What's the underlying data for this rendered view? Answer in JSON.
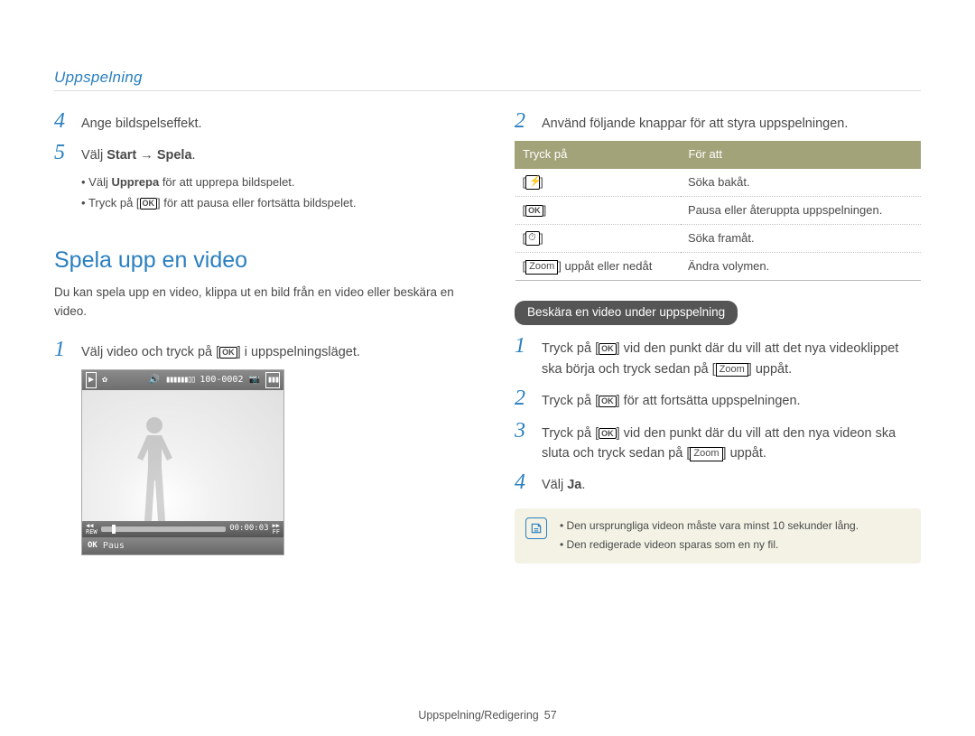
{
  "header": {
    "title": "Uppspelning"
  },
  "left": {
    "step4": {
      "num": "4",
      "text": "Ange bildspelseffekt."
    },
    "step5": {
      "num": "5",
      "pre": "Välj ",
      "b1": "Start",
      "arrow": " → ",
      "b2": "Spela",
      "post": "."
    },
    "bullets": {
      "a_pre": "Välj ",
      "a_bold": "Upprepa",
      "a_post": " för att upprepa bildspelet.",
      "b_pre": "Tryck på [",
      "b_post": "] för att pausa eller fortsätta bildspelet."
    },
    "section_title": "Spela upp en video",
    "lede": "Du kan spela upp en video, klippa ut en bild från en video eller beskära en video.",
    "step1": {
      "num": "1",
      "pre": "Välj video och tryck på [",
      "post": "] i uppspelningsläget."
    },
    "camera": {
      "top_counter": "100-0002",
      "vol_bars": "▮▮▮▮▮▮▯▯",
      "vol_icon": "🔊",
      "bat": "▮▮▮",
      "rew": "REW",
      "time": "00:00:03",
      "ff": "FF",
      "ok": "OK",
      "paus": "Paus",
      "play_icon": "▶"
    }
  },
  "right": {
    "step2": {
      "num": "2",
      "text": "Använd följande knappar för att styra uppspelningen."
    },
    "table": {
      "h1": "Tryck på",
      "h2": "För att",
      "rows": [
        {
          "icon": "flash",
          "desc": "Söka bakåt."
        },
        {
          "icon": "ok",
          "desc": "Pausa eller återuppta uppspelningen."
        },
        {
          "icon": "timer",
          "desc": "Söka framåt."
        },
        {
          "zoom_label": "Zoom",
          "zoom_suffix": " uppåt eller nedåt",
          "desc": "Ändra volymen."
        }
      ]
    },
    "pill": "Beskära en video under uppspelning",
    "trim": {
      "s1": {
        "num": "1",
        "pre": "Tryck på [",
        "mid": "] vid den punkt där du vill att det nya videoklippet ska börja och tryck sedan på [",
        "zoom": "Zoom",
        "post": "] uppåt."
      },
      "s2": {
        "num": "2",
        "pre": "Tryck på [",
        "post": "] för att fortsätta uppspelningen."
      },
      "s3": {
        "num": "3",
        "pre": "Tryck på [",
        "mid": "] vid den punkt där du vill att den nya videon ska sluta och tryck sedan på [",
        "zoom": "Zoom",
        "post": "] uppåt."
      },
      "s4": {
        "num": "4",
        "pre": "Välj ",
        "bold": "Ja",
        "post": "."
      }
    },
    "note": {
      "a": "Den ursprungliga videon måste vara minst 10 sekunder lång.",
      "b": "Den redigerade videon sparas som en ny fil."
    }
  },
  "footer": {
    "text": "Uppspelning/Redigering",
    "page": "57"
  },
  "ok_label": "OK"
}
